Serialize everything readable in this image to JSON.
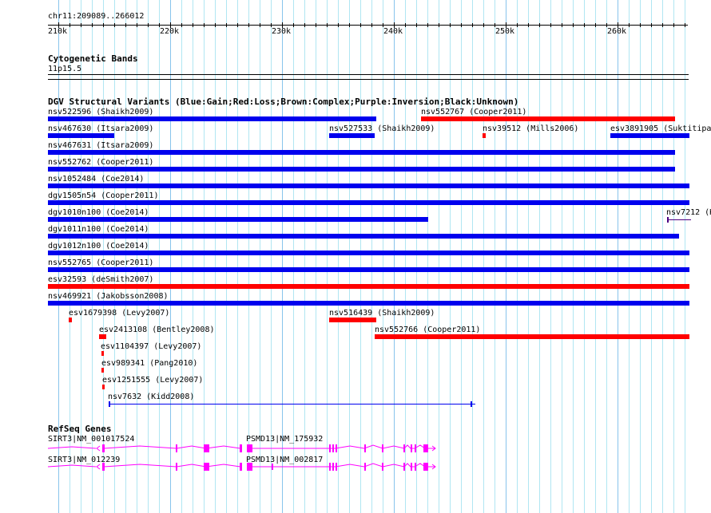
{
  "ruler": {
    "range": "chr11:209089..266012",
    "ticks": [
      "210k",
      "220k",
      "230k",
      "240k",
      "250k",
      "260k"
    ]
  },
  "cytoband": {
    "title": "Cytogenetic Bands",
    "band": "11p15.5"
  },
  "dgv": {
    "title": "DGV Structural Variants (Blue:Gain;Red:Loss;Brown:Complex;Purple:Inversion;Black:Unknown)",
    "colors": {
      "gain": "#0000ee",
      "loss": "#ff0000",
      "inversion": "#4b0082"
    },
    "features": [
      {
        "label": "nsv522596 (Shaikh2009)",
        "type": "gain"
      },
      {
        "label": "nsv552767 (Cooper2011)",
        "type": "loss"
      },
      {
        "label": "nsv467630 (Itsara2009)",
        "type": "gain"
      },
      {
        "label": "nsv527533 (Shaikh2009)",
        "type": "gain"
      },
      {
        "label": "nsv39512 (Mills2006)",
        "type": "loss"
      },
      {
        "label": "esv3891905 (Suktitipat",
        "type": "gain"
      },
      {
        "label": "nsv467631 (Itsara2009)",
        "type": "gain"
      },
      {
        "label": "nsv552762 (Cooper2011)",
        "type": "gain"
      },
      {
        "label": "nsv1052484 (Coe2014)",
        "type": "gain"
      },
      {
        "label": "dgv1505n54 (Cooper2011)",
        "type": "gain"
      },
      {
        "label": "dgv1010n100 (Coe2014)",
        "type": "gain"
      },
      {
        "label": "nsv7212 (K",
        "type": "inversion"
      },
      {
        "label": "dgv1011n100 (Coe2014)",
        "type": "gain"
      },
      {
        "label": "dgv1012n100 (Coe2014)",
        "type": "gain"
      },
      {
        "label": "nsv552765 (Cooper2011)",
        "type": "gain"
      },
      {
        "label": "esv32593 (deSmith2007)",
        "type": "loss"
      },
      {
        "label": "nsv469921 (Jakobsson2008)",
        "type": "gain"
      },
      {
        "label": "esv1679398 (Levy2007)",
        "type": "loss"
      },
      {
        "label": "nsv516439 (Shaikh2009)",
        "type": "loss"
      },
      {
        "label": "esv2413108 (Bentley2008)",
        "type": "loss"
      },
      {
        "label": "nsv552766 (Cooper2011)",
        "type": "loss"
      },
      {
        "label": "esv1104397 (Levy2007)",
        "type": "loss"
      },
      {
        "label": "esv989341 (Pang2010)",
        "type": "loss"
      },
      {
        "label": "esv1251555 (Levy2007)",
        "type": "loss"
      },
      {
        "label": "nsv7632 (Kidd2008)",
        "type": "gain"
      }
    ]
  },
  "refseq": {
    "title": "RefSeq Genes",
    "color": "#ff00ff",
    "transcripts": [
      {
        "gene1": "SIRT3|NM_001017524",
        "gene2": "PSMD13|NM_175932"
      },
      {
        "gene1": "SIRT3|NM_012239",
        "gene2": "PSMD13|NM_002817"
      }
    ]
  }
}
